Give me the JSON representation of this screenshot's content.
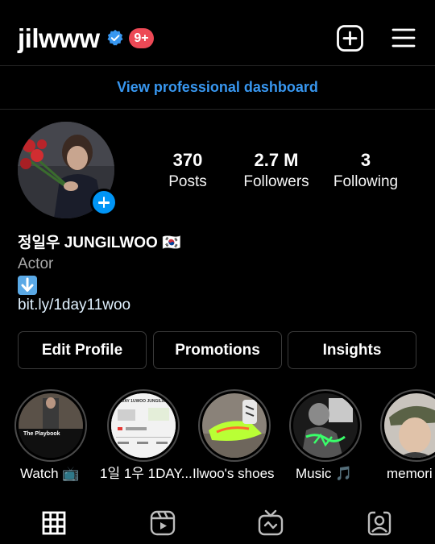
{
  "header": {
    "username": "jilwww",
    "notification_count": "9+"
  },
  "dashboard": {
    "label": "View professional dashboard"
  },
  "stats": [
    {
      "value": "370",
      "label": "Posts"
    },
    {
      "value": "2.7 M",
      "label": "Followers"
    },
    {
      "value": "3",
      "label": "Following"
    }
  ],
  "bio": {
    "name": "정일우 JUNGILWOO 🇰🇷",
    "category": "Actor",
    "link": "bit.ly/1day11woo"
  },
  "buttons": {
    "edit_profile": "Edit Profile",
    "promotions": "Promotions",
    "insights": "Insights"
  },
  "highlights": [
    {
      "label": "Watch 📺",
      "cover_text": "The Playbook"
    },
    {
      "label": "1일 1우 1DAY...",
      "cover_text": "1DAY 1UWOO JUNGILWOO"
    },
    {
      "label": "Ilwoo's shoes"
    },
    {
      "label": "Music 🎵"
    },
    {
      "label": "memori"
    }
  ],
  "colors": {
    "background": "#000000",
    "accent_blue": "#3897f0",
    "badge_red": "#ed4956",
    "border": "#3a3a3a"
  },
  "icons": {
    "verified": "verified-badge-icon",
    "new_post": "plus-square-icon",
    "menu": "hamburger-menu-icon",
    "avatar_add": "plus-icon",
    "bio_arrow": "down-arrow-icon",
    "tabs": [
      "grid-icon",
      "reels-icon",
      "igtv-icon",
      "tagged-icon"
    ]
  }
}
